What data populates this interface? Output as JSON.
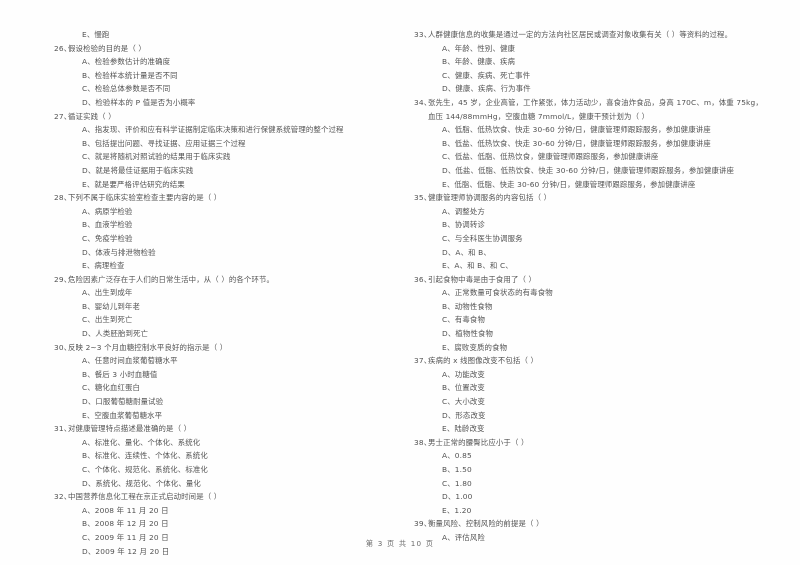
{
  "document": {
    "page_label": "第 3 页 共 10 页",
    "text_color": "#525252",
    "background_color": "#fefefe"
  },
  "left_column": {
    "orphan_option": "E、慢跑",
    "questions": [
      {
        "number": "26、",
        "stem": "假设检验的目的是（      ）",
        "options": [
          "A、检验参数估计的准确度",
          "B、检验样本统计量是否不同",
          "C、检验总体参数是否不同",
          "D、检验样本的 P 值是否为小概率"
        ]
      },
      {
        "number": "27、",
        "stem": "循证实践（      ）",
        "options": [
          "A、指发现、评价和应有科学证据制定临床决策和进行保健系统管理的整个过程",
          "B、包括提出问题、寻找证据、应用证据三个过程",
          "C、就是将随机对照试验的结果用于临床实践",
          "D、就是将最佳证据用于临床实践",
          "E、就是要严格评估研究的结果"
        ]
      },
      {
        "number": "28、",
        "stem": "下列不属于临床实验室检查主要内容的是（      ）",
        "options": [
          "A、病原学检验",
          "B、血液学检验",
          "C、免疫学检验",
          "D、体液与排泄物检验",
          "E、病理检查"
        ]
      },
      {
        "number": "29、",
        "stem": "危险因素广泛存在于人们的日常生活中，从（      ）的各个环节。",
        "options": [
          "A、出生到成年",
          "B、婴幼儿到年老",
          "C、出生到死亡",
          "D、人类胚胎到死亡"
        ]
      },
      {
        "number": "30、",
        "stem": "反映 2~3 个月血糖控制水平良好的指示是（      ）",
        "options": [
          "A、任意时间血浆葡萄糖水平",
          "B、餐后 3 小时血糖值",
          "C、糖化血红蛋白",
          "D、口服葡萄糖耐量试验",
          "E、空腹血浆葡萄糖水平"
        ]
      },
      {
        "number": "31、",
        "stem": "对健康管理特点描述最准确的是（      ）",
        "options": [
          "A、标准化、量化、个体化、系统化",
          "B、标准化、连续性、个体化、系统化",
          "C、个体化、规范化、系统化、标准化",
          "D、系统化、规范化、个体化、量化"
        ]
      },
      {
        "number": "32、",
        "stem": "中国营养信息化工程在京正式启动时间是（      ）",
        "options": [
          "A、2008 年 11 月 20 日",
          "B、2008 年 12 月 20 日",
          "C、2009 年 11 月 20 日",
          "D、2009 年 12 月 20 日"
        ]
      }
    ]
  },
  "right_column": {
    "questions": [
      {
        "number": "33、",
        "stem": "人群健康信息的收集是通过一定的方法向社区居民或调查对象收集有关（      ）等资料的过程。",
        "options": [
          "A、年龄、性别、健康",
          "B、年龄、健康、疾病",
          "C、健康、疾病、死亡事件",
          "D、健康、疾病、行为事件"
        ]
      },
      {
        "number": "34、",
        "stem": "张先生，45 岁，企业高管，工作紧张，体力活动少，喜食油炸食品，身高 170C、m，体重 75kg，血压 144/88mmHg，空腹血糖 7mmol/L，健康干预计划为（      ）",
        "options": [
          "A、低脂、低热饮食、快走 30-60 分钟/日，健康管理师跟踪服务，参加健康讲座",
          "B、低盐、低热饮食、快走 30-60 分钟/日，健康管理师跟踪服务，参加健康讲座",
          "C、低盐、低脂、低热饮食，健康管理师跟踪服务，参加健康讲座",
          "D、低盐、低脂、低热饮食、快走 30-60 分钟/日，健康管理师跟踪服务，参加健康讲座",
          "E、低脂、低脂、快走 30-60 分钟/日，健康管理师跟踪服务，参加健康讲座"
        ]
      },
      {
        "number": "35、",
        "stem": "健康管理师协调服务的内容包括（      ）",
        "options": [
          "A、调整处方",
          "B、协调转诊",
          "C、与全科医生协调服务",
          "D、A、和 B、",
          "E、A、和 B、和 C、"
        ]
      },
      {
        "number": "36、",
        "stem": "引起食物中毒是由于食用了（      ）",
        "options": [
          "A、正常数量可食状态的有毒食物",
          "B、动物性食物",
          "C、有毒食物",
          "D、植物性食物",
          "E、腐败变质的食物"
        ]
      },
      {
        "number": "37、",
        "stem": "疾病的 x 线图像改变不包括（      ）",
        "options": [
          "A、功能改变",
          "B、位置改变",
          "C、大小改变",
          "D、形态改变",
          "E、陆龄改变"
        ]
      },
      {
        "number": "38、",
        "stem": "男士正常的腰臀比应小于（      ）",
        "options": [
          "A、0.85",
          "B、1.50",
          "C、1.80",
          "D、1.00",
          "E、1.20"
        ]
      },
      {
        "number": "39、",
        "stem": "衡量风险、控制风险的前提是（      ）",
        "options": [
          "A、评估风险"
        ]
      }
    ]
  }
}
